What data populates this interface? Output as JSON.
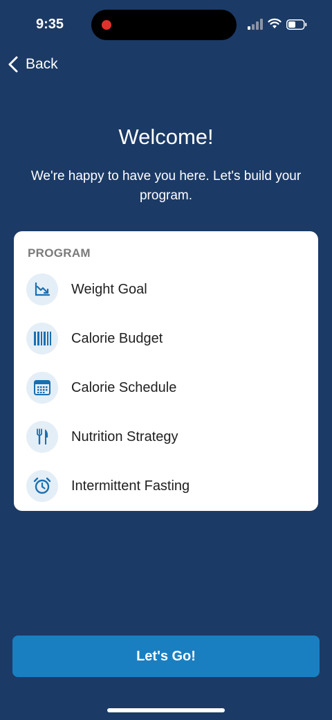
{
  "status_bar": {
    "time": "9:35",
    "icons": [
      "recording-dot",
      "signal-icon",
      "wifi-icon",
      "battery-icon"
    ]
  },
  "nav": {
    "back_label": "Back",
    "back_icon": "chevron-left-icon"
  },
  "header": {
    "title": "Welcome!",
    "subtitle": "We're happy to have you here. Let's build your program."
  },
  "program": {
    "heading": "PROGRAM",
    "items": [
      {
        "label": "Weight Goal",
        "icon": "trending-down-chart-icon"
      },
      {
        "label": "Calorie Budget",
        "icon": "barcode-bars-icon"
      },
      {
        "label": "Calorie Schedule",
        "icon": "calendar-icon"
      },
      {
        "label": "Nutrition Strategy",
        "icon": "fork-knife-icon"
      },
      {
        "label": "Intermittent Fasting",
        "icon": "alarm-clock-icon"
      }
    ]
  },
  "cta": {
    "label": "Let's Go!"
  },
  "colors": {
    "background": "#1b3a66",
    "card": "#ffffff",
    "icon_accent": "#1a6fb0",
    "icon_bg": "#e4eef7",
    "button": "#1a7fc1",
    "recording": "#e0322b"
  }
}
